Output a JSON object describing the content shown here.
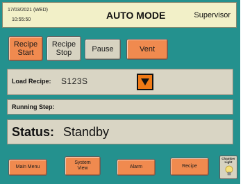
{
  "header": {
    "date": "17/03/2021 (WED)",
    "time": "10:55:50",
    "mode": "AUTO MODE",
    "user": "Supervisor"
  },
  "controls": {
    "recipe_start": {
      "line1": "Recipe",
      "line2": "Start"
    },
    "recipe_stop": {
      "line1": "Recipe",
      "line2": "Stop"
    },
    "pause": "Pause",
    "vent": "Vent"
  },
  "load_recipe": {
    "label": "Load Recipe:",
    "value": "S123S"
  },
  "running_step": {
    "label": "Running Step:"
  },
  "status": {
    "label": "Status:",
    "value": "Standby"
  },
  "nav": {
    "main_menu": "Main Menu",
    "system_view": {
      "line1": "System",
      "line2": "View"
    },
    "alarm": "Alarm",
    "recipe": "Recipe",
    "chamber_light": {
      "line1": "Chamber",
      "line2": "Light"
    }
  },
  "colors": {
    "background": "#24918e",
    "header_bg": "#f2f0c8",
    "panel_bg": "#d9d5c4",
    "button_orange": "#f08a4f",
    "button_grey": "#d7d3c1",
    "dropdown_orange": "#f07a16"
  },
  "icons": {
    "dropdown": "triangle-down-icon",
    "chamber_light": "light-bulb-icon"
  }
}
